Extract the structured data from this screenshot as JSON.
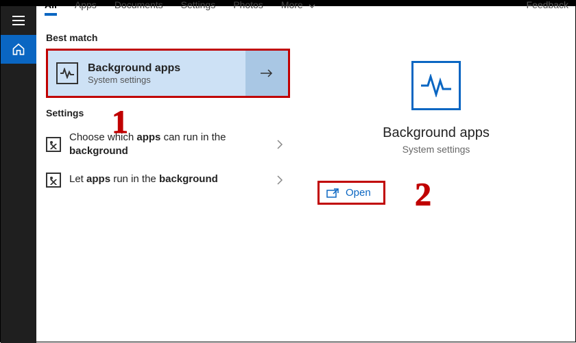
{
  "tabs": {
    "all": "All",
    "apps": "Apps",
    "documents": "Documents",
    "settings": "Settings",
    "photos": "Photos",
    "more": "More",
    "feedback": "Feedback"
  },
  "sections": {
    "best_match": "Best match",
    "settings": "Settings"
  },
  "best_match": {
    "title": "Background apps",
    "subtitle": "System settings"
  },
  "setting_rows": [
    {
      "pre": "Choose which ",
      "b1": "apps",
      "mid": " can run in the ",
      "b2": "background"
    },
    {
      "pre": "Let ",
      "b1": "apps",
      "mid": " run in the ",
      "b2": "background"
    }
  ],
  "detail": {
    "title": "Background apps",
    "subtitle": "System settings",
    "open": "Open"
  },
  "annotations": {
    "one": "1",
    "two": "2"
  }
}
